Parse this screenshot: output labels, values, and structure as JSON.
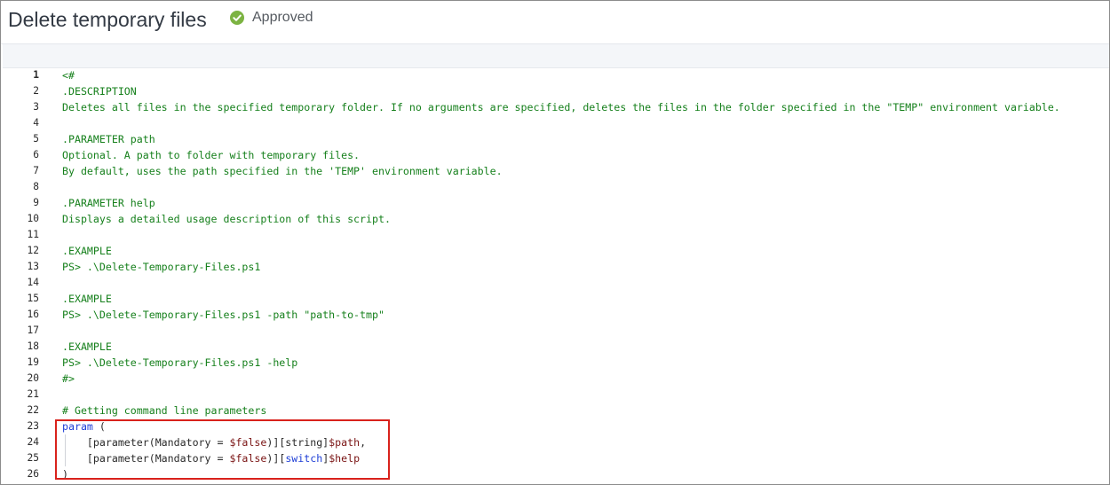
{
  "header": {
    "title": "Delete temporary files",
    "status_label": "Approved",
    "status_color": "#7cb342",
    "status_icon": "check-circle-icon"
  },
  "editor": {
    "language": "powershell",
    "active_line": 1,
    "lines": [
      {
        "n": "1",
        "tokens": [
          {
            "t": "<#",
            "c": "comment"
          }
        ]
      },
      {
        "n": "2",
        "tokens": [
          {
            "t": ".DESCRIPTION",
            "c": "comment"
          }
        ]
      },
      {
        "n": "3",
        "tokens": [
          {
            "t": "Deletes all files in the specified temporary folder. If no arguments are specified, deletes the files in the folder specified in the \"TEMP\" environment variable.",
            "c": "comment"
          }
        ]
      },
      {
        "n": "4",
        "tokens": []
      },
      {
        "n": "5",
        "tokens": [
          {
            "t": ".PARAMETER path",
            "c": "comment"
          }
        ]
      },
      {
        "n": "6",
        "tokens": [
          {
            "t": "Optional. A path to folder with temporary files.",
            "c": "comment"
          }
        ]
      },
      {
        "n": "7",
        "tokens": [
          {
            "t": "By default, uses the path specified in the 'TEMP' environment variable.",
            "c": "comment"
          }
        ]
      },
      {
        "n": "8",
        "tokens": []
      },
      {
        "n": "9",
        "tokens": [
          {
            "t": ".PARAMETER help",
            "c": "comment"
          }
        ]
      },
      {
        "n": "10",
        "tokens": [
          {
            "t": "Displays a detailed usage description of this script.",
            "c": "comment"
          }
        ]
      },
      {
        "n": "11",
        "tokens": []
      },
      {
        "n": "12",
        "tokens": [
          {
            "t": ".EXAMPLE",
            "c": "comment"
          }
        ]
      },
      {
        "n": "13",
        "tokens": [
          {
            "t": "PS> .\\Delete-Temporary-Files.ps1",
            "c": "comment"
          }
        ]
      },
      {
        "n": "14",
        "tokens": []
      },
      {
        "n": "15",
        "tokens": [
          {
            "t": ".EXAMPLE",
            "c": "comment"
          }
        ]
      },
      {
        "n": "16",
        "tokens": [
          {
            "t": "PS> .\\Delete-Temporary-Files.ps1 -path \"path-to-tmp\"",
            "c": "comment"
          }
        ]
      },
      {
        "n": "17",
        "tokens": []
      },
      {
        "n": "18",
        "tokens": [
          {
            "t": ".EXAMPLE",
            "c": "comment"
          }
        ]
      },
      {
        "n": "19",
        "tokens": [
          {
            "t": "PS> .\\Delete-Temporary-Files.ps1 -help",
            "c": "comment"
          }
        ]
      },
      {
        "n": "20",
        "tokens": [
          {
            "t": "#>",
            "c": "comment"
          }
        ]
      },
      {
        "n": "21",
        "tokens": []
      },
      {
        "n": "22",
        "tokens": [
          {
            "t": "# Getting command line parameters",
            "c": "comment"
          }
        ]
      },
      {
        "n": "23",
        "tokens": [
          {
            "t": "param",
            "c": "keyword"
          },
          {
            "t": " (",
            "c": "plain"
          }
        ]
      },
      {
        "n": "24",
        "tokens": [
          {
            "t": "    [parameter(Mandatory = ",
            "c": "plain"
          },
          {
            "t": "$false",
            "c": "variable"
          },
          {
            "t": ")][string]",
            "c": "plain"
          },
          {
            "t": "$path",
            "c": "variable"
          },
          {
            "t": ",",
            "c": "plain"
          }
        ]
      },
      {
        "n": "25",
        "tokens": [
          {
            "t": "    [parameter(Mandatory = ",
            "c": "plain"
          },
          {
            "t": "$false",
            "c": "variable"
          },
          {
            "t": ")][",
            "c": "plain"
          },
          {
            "t": "switch",
            "c": "keyword"
          },
          {
            "t": "]",
            "c": "plain"
          },
          {
            "t": "$help",
            "c": "variable"
          }
        ]
      },
      {
        "n": "26",
        "tokens": [
          {
            "t": ")",
            "c": "plain"
          }
        ]
      }
    ]
  },
  "annotation": {
    "highlight_color": "#d9221c"
  }
}
